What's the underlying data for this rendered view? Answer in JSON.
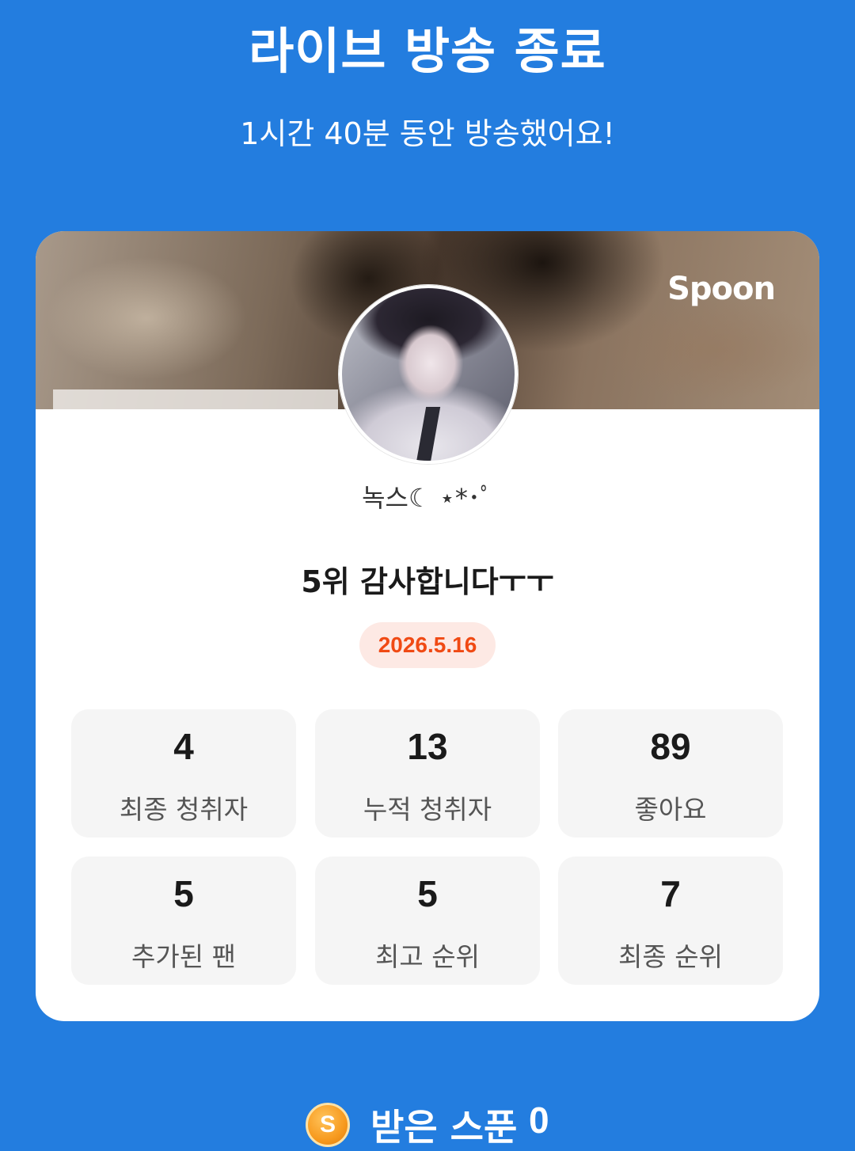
{
  "header": {
    "title": "라이브 방송 종료",
    "subtitle": "1시간 40분 동안 방송했어요!"
  },
  "card": {
    "brand": "Spoon",
    "nickname": "녹스☾ ⋆*･ﾟ",
    "headline": "5위 감사합니다ㅜㅜ",
    "date": "2026.5.16",
    "stats": [
      {
        "value": "4",
        "label": "최종 청취자"
      },
      {
        "value": "13",
        "label": "누적 청취자"
      },
      {
        "value": "89",
        "label": "좋아요"
      },
      {
        "value": "5",
        "label": "추가된 팬"
      },
      {
        "value": "5",
        "label": "최고 순위"
      },
      {
        "value": "7",
        "label": "최종 순위"
      }
    ]
  },
  "spoons": {
    "icon": "spoon-coin-icon",
    "coin_letter": "S",
    "label": "받은 스푼",
    "count": "0"
  },
  "colors": {
    "background": "#237ddf",
    "date_text": "#f04a14",
    "date_badge_bg": "#fde9e4",
    "stat_tile_bg": "#f5f5f5"
  }
}
